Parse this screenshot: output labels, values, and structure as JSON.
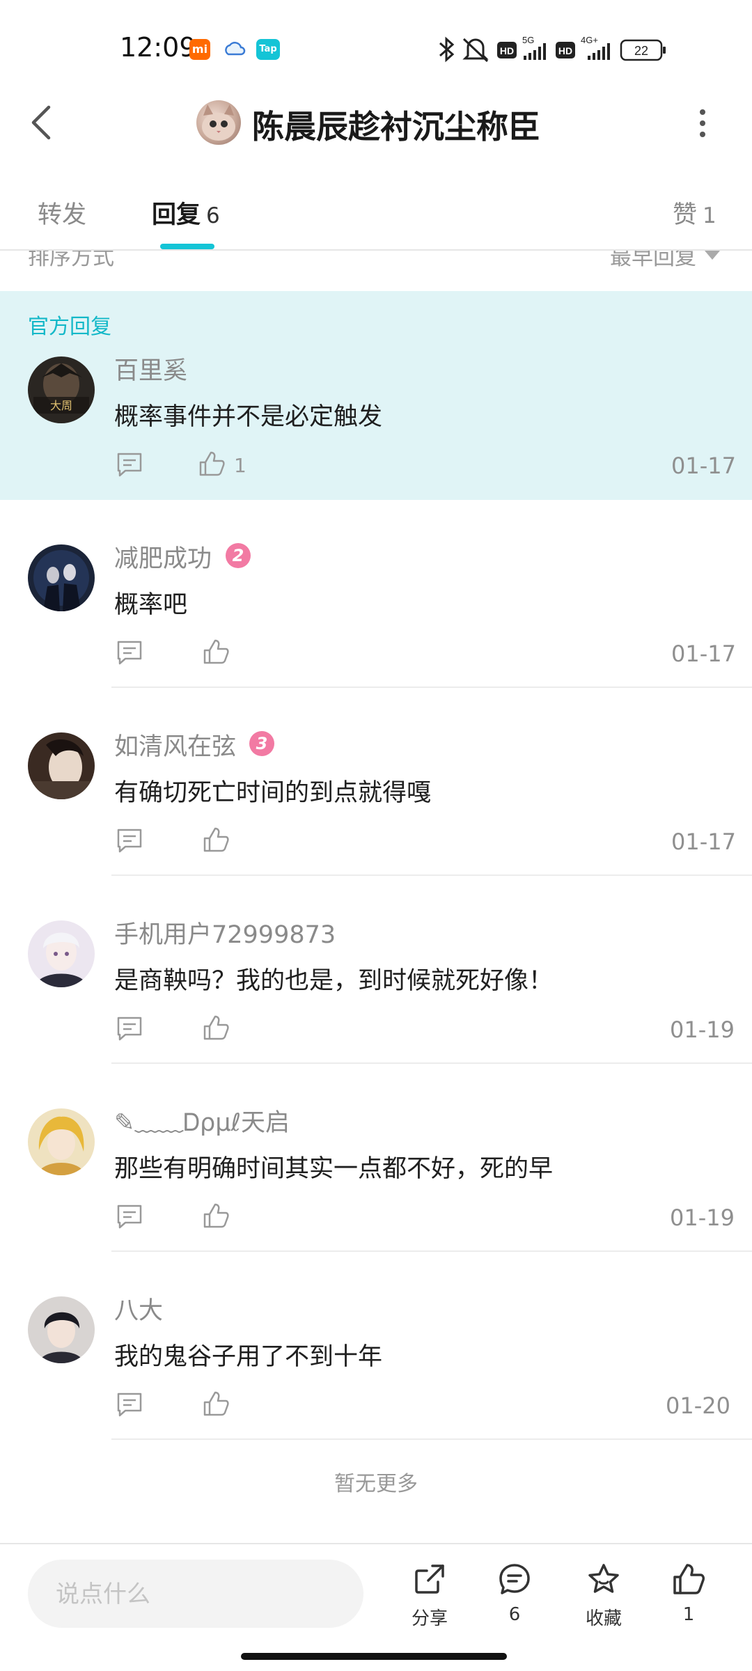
{
  "status_bar": {
    "time": "12:09",
    "app_badges": [
      "mi-icon",
      "cloud-icon",
      "tap-icon"
    ],
    "tap_badge_text": "Tap",
    "mi_badge_text": "mi",
    "network_5g": "5G",
    "network_4g": "4G+",
    "hd": "HD",
    "battery": "22"
  },
  "header": {
    "title": "陈晨辰趁衬沉尘称臣"
  },
  "tabs": {
    "forward": "转发",
    "reply": "回复",
    "reply_count": "6",
    "like": "赞",
    "like_count": "1"
  },
  "sort": {
    "label": "排序方式",
    "value": "最早回复"
  },
  "official": {
    "label": "官方回复",
    "name": "百里奚",
    "text": "概率事件并不是必定触发",
    "like_count": "1",
    "date": "01-17"
  },
  "comments": [
    {
      "name": "减肥成功",
      "level": "2",
      "text": "概率吧",
      "date": "01-17"
    },
    {
      "name": "如清风在弦",
      "level": "3",
      "text": "有确切死亡时间的到点就得嘎",
      "date": "01-17"
    },
    {
      "name": "手机用户72999873",
      "text": "是商鞅吗？我的也是，到时候就死好像！",
      "date": "01-19"
    },
    {
      "name": "✎﹏﹏Ꭰρμℓ天启",
      "text": "那些有明确时间其实一点都不好，死的早",
      "date": "01-19"
    },
    {
      "name": "八大",
      "text": "我的鬼谷子用了不到十年",
      "date": "01-20"
    }
  ],
  "footer_text": "暂无更多",
  "bottom_bar": {
    "input_placeholder": "说点什么",
    "share_label": "分享",
    "comment_count": "6",
    "favorite_label": "收藏",
    "like_count": "1"
  },
  "colors": {
    "accent": "#14c4d6",
    "official_bg": "#e0f4f6",
    "level2": "#f27aa3",
    "level3": "#f27aa3"
  }
}
